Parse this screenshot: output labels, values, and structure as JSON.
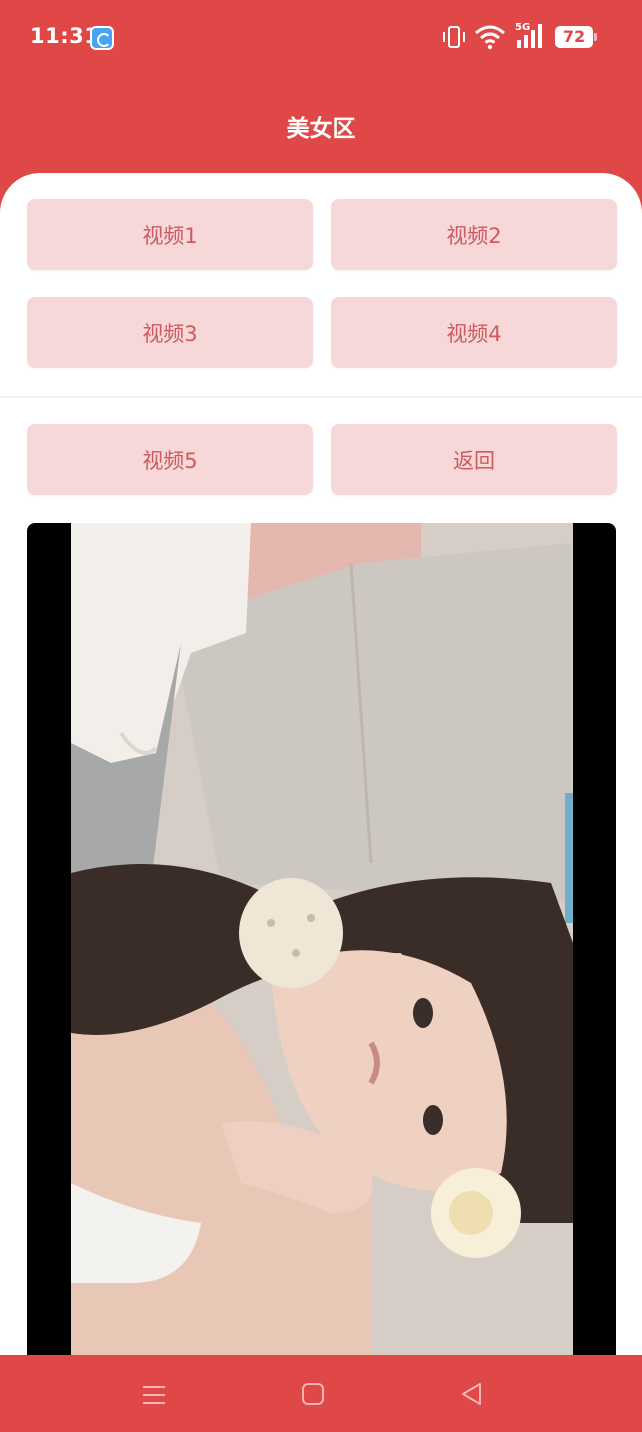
{
  "status_bar": {
    "time": "11:31",
    "battery": "72",
    "icons": [
      "app-notification-icon",
      "vibrate-icon",
      "wifi-icon",
      "5g-signal-icon",
      "battery-icon"
    ],
    "network_label": "5G"
  },
  "header": {
    "title": "美女区"
  },
  "buttons": {
    "video1": "视频1",
    "video2": "视频2",
    "video3": "视频3",
    "video4": "视频4",
    "video5": "视频5",
    "back": "返回"
  },
  "video": {
    "content": "portrait video of a woman lying on a beige sofa"
  },
  "nav_bar": {
    "icons": [
      "menu-icon",
      "home-icon",
      "back-icon"
    ]
  },
  "colors": {
    "accent": "#e04848",
    "button_bg": "#f6d8d9",
    "button_text": "#cf5a5e"
  }
}
